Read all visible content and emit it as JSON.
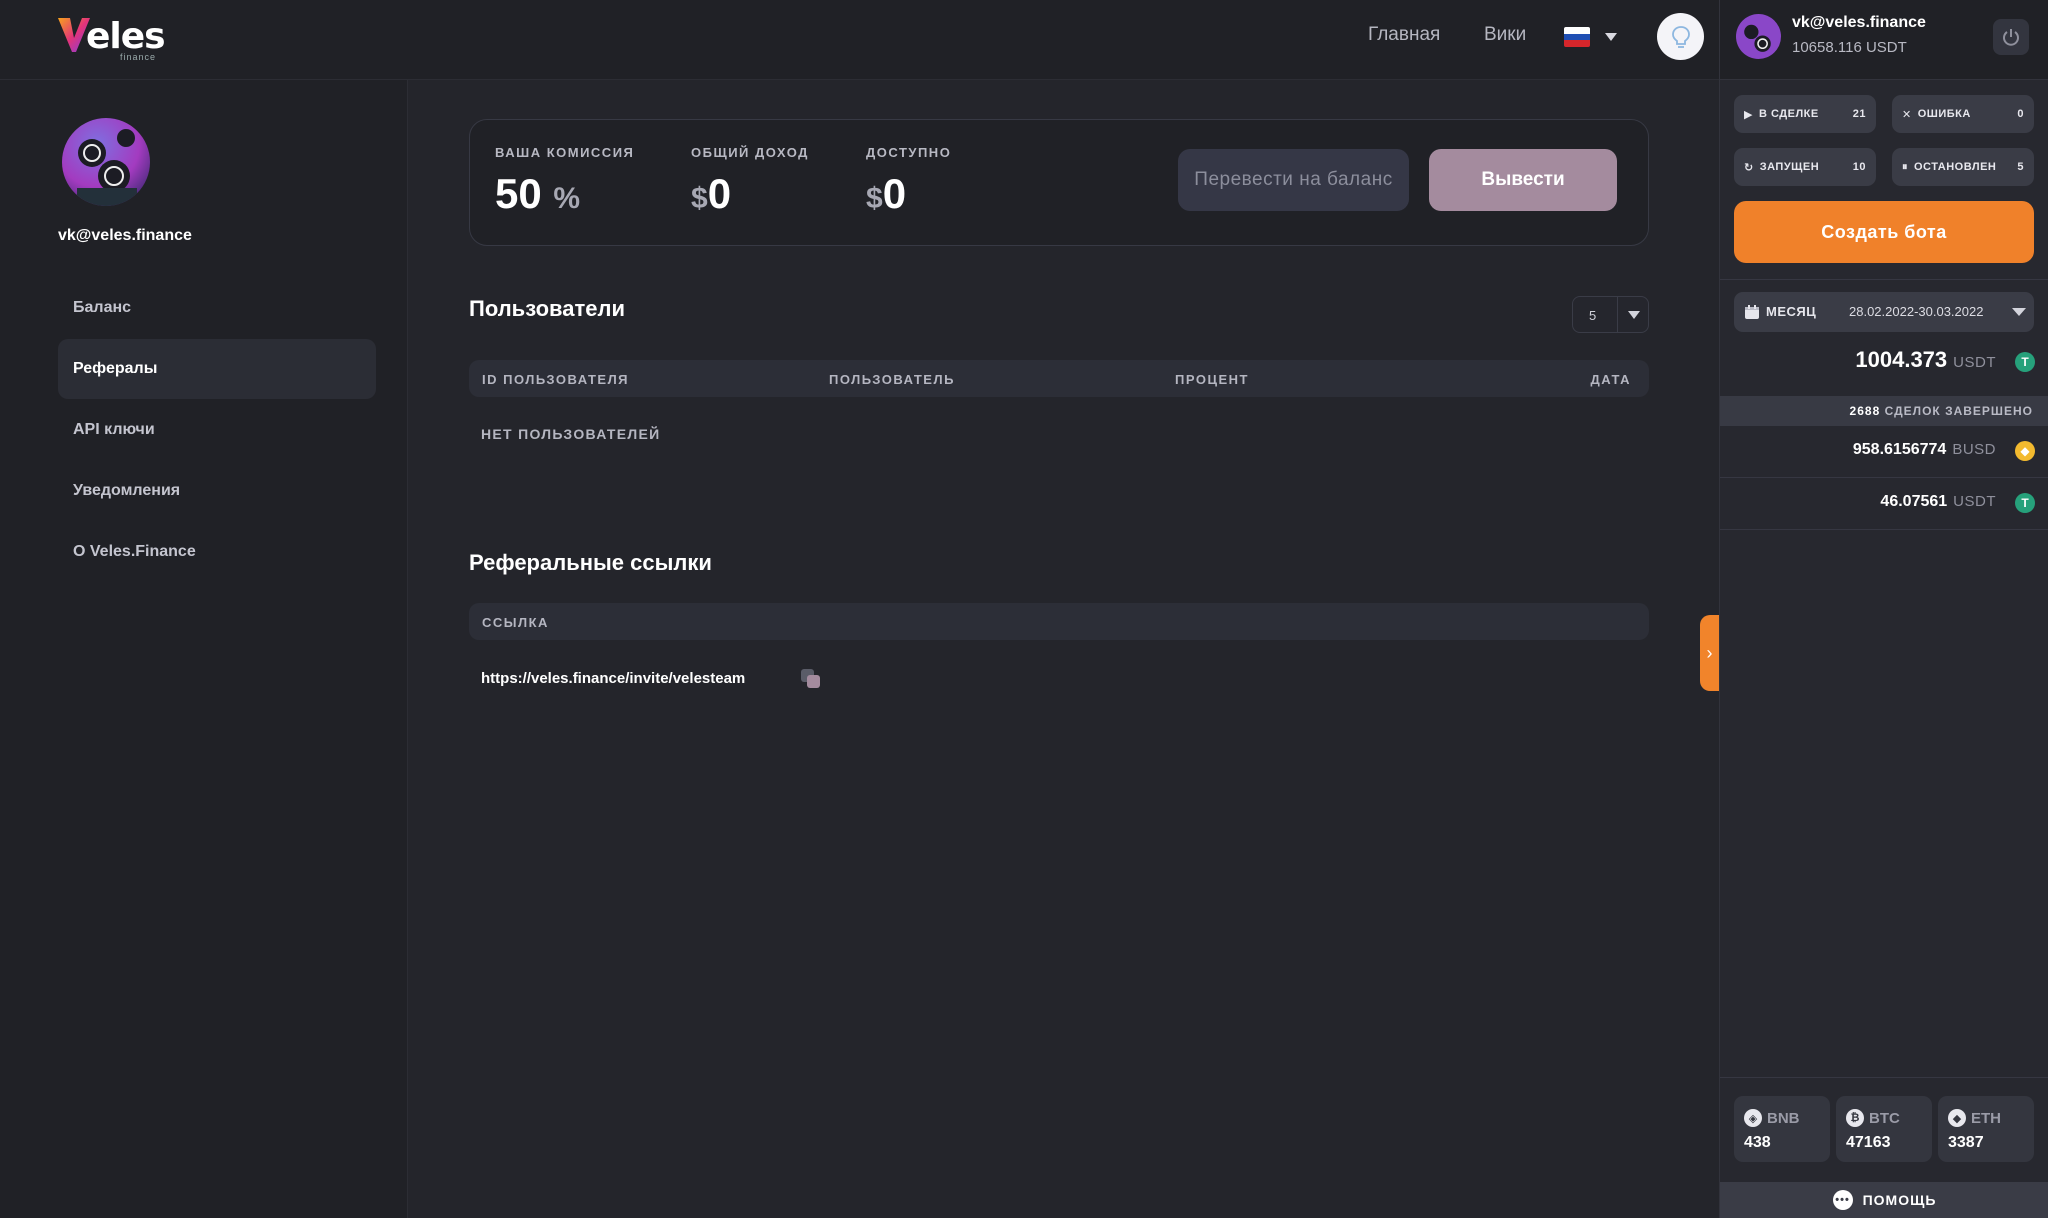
{
  "header": {
    "logo_text": "eles",
    "logo_sub": "finance",
    "nav": [
      {
        "label": "Главная"
      },
      {
        "label": "Вики"
      }
    ],
    "flag_colors": [
      "#ffffff",
      "#1f4fb4",
      "#d5262b"
    ]
  },
  "sidebar": {
    "email": "vk@veles.finance",
    "items": [
      {
        "label": "Баланс",
        "active": false
      },
      {
        "label": "Рефералы",
        "active": true
      },
      {
        "label": "API ключи",
        "active": false
      },
      {
        "label": "Уведомления",
        "active": false
      },
      {
        "label": "О Veles.Finance",
        "active": false
      }
    ]
  },
  "stats": {
    "commission_label": "ВАША КОМИССИЯ",
    "commission_value": "50",
    "commission_unit": "%",
    "income_label": "ОБЩИЙ ДОХОД",
    "income_currency": "$",
    "income_value": "0",
    "available_label": "ДОСТУПНО",
    "available_currency": "$",
    "available_value": "0",
    "transfer_button": "Перевести на баланс",
    "withdraw_button": "Вывести"
  },
  "users": {
    "title": "Пользователи",
    "page_size": "5",
    "columns": [
      "ID ПОЛЬЗОВАТЕЛЯ",
      "ПОЛЬЗОВАТЕЛЬ",
      "ПРОЦЕНТ",
      "ДАТА"
    ],
    "empty_text": "НЕТ ПОЛЬЗОВАТЕЛЕЙ"
  },
  "referral_links": {
    "title": "Реферальные ссылки",
    "column": "ССЫЛКА",
    "link": "https://veles.finance/invite/velesteam"
  },
  "right_panel": {
    "email": "vk@veles.finance",
    "balance": "10658.116 USDT",
    "chips": [
      {
        "label": "В СДЕЛКЕ",
        "count": "21",
        "icon": "play-icon"
      },
      {
        "label": "ОШИБКА",
        "count": "0",
        "icon": "x-icon"
      },
      {
        "label": "ЗАПУЩЕН",
        "count": "10",
        "icon": "restart-icon"
      },
      {
        "label": "ОСТАНОВЛЕН",
        "count": "5",
        "icon": "pause-icon"
      }
    ],
    "create_button": "Создать бота",
    "period_label": "МЕСЯЦ",
    "period_dates": "28.02.2022-30.03.2022",
    "total_value": "1004.373",
    "total_unit": "USDT",
    "deals_count": "2688",
    "deals_label": "СДЕЛОК ЗАВЕРШЕНО",
    "amounts": [
      {
        "value": "958.6156774",
        "unit": "BUSD",
        "coin_color": "#f3ba2f"
      },
      {
        "value": "46.07561",
        "unit": "USDT",
        "coin_color": "#26a17b"
      }
    ],
    "tickers": [
      {
        "name": "BNB",
        "price": "438",
        "icon": "bnb-icon"
      },
      {
        "name": "BTC",
        "price": "47163",
        "icon": "btc-icon"
      },
      {
        "name": "ETH",
        "price": "3387",
        "icon": "eth-icon"
      }
    ],
    "help": "ПОМОЩЬ"
  },
  "colors": {
    "accent_orange": "#f0812a",
    "withdraw_button": "#a48b9e",
    "usdt_green": "#26a17b",
    "busd_yellow": "#f3ba2f"
  }
}
